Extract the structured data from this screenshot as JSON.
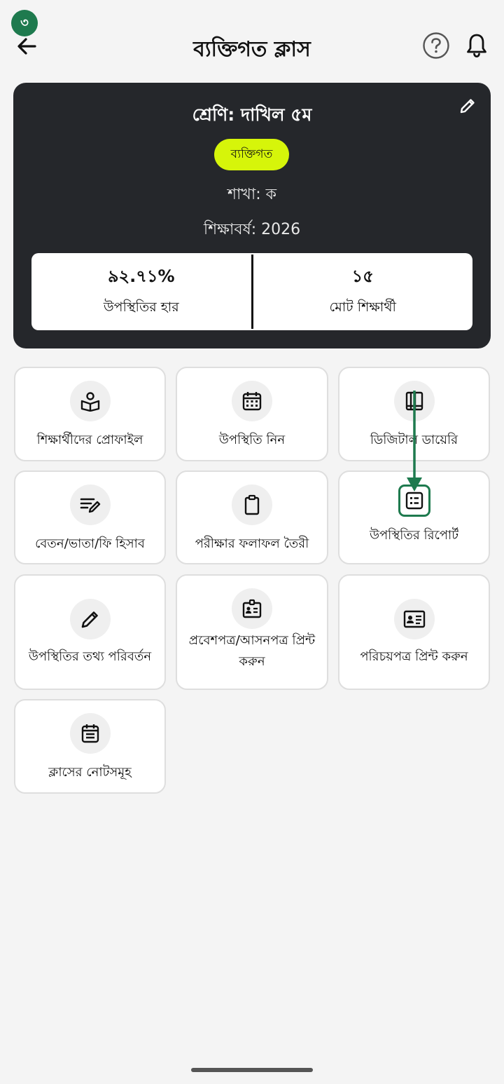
{
  "step_badge": "৩",
  "header": {
    "title": "ব্যক্তিগত ক্লাস",
    "icons": {
      "back": "arrow-left-icon",
      "help": "question-circle-icon",
      "notify": "bell-icon"
    }
  },
  "class_card": {
    "class_name": "শ্রেণি: দাখিল ৫ম",
    "type_chip": "ব্যক্তিগত",
    "section": "শাখা: ক",
    "academic_year": "শিক্ষাবর্ষ: 2026",
    "stats": [
      {
        "value": "৯২.৭১%",
        "label": "উপস্থিতির হার"
      },
      {
        "value": "১৫",
        "label": "মোট শিক্ষার্থী"
      }
    ],
    "edit_icon": "pencil-icon"
  },
  "tiles": [
    {
      "label": "শিক্ষার্থীদের প্রোফাইল",
      "icon": "student-profile-icon"
    },
    {
      "label": "উপস্থিতি নিন",
      "icon": "calendar-grid-icon"
    },
    {
      "label": "ডিজিটাল ডায়েরি",
      "icon": "diary-book-icon"
    },
    {
      "label": "বেতন/ভাতা/ফি হিসাব",
      "icon": "edit-list-icon"
    },
    {
      "label": "পরীক্ষার ফলাফল তৈরী",
      "icon": "clipboard-icon"
    },
    {
      "label": "উপস্থিতির রিপোর্ট",
      "icon": "report-list-icon"
    },
    {
      "label": "উপস্থিতির তথ্য পরিবর্তন",
      "icon": "pencil-icon"
    },
    {
      "label": "প্রবেশপত্র/আসনপত্র প্রিন্ট করুন",
      "icon": "id-badge-icon"
    },
    {
      "label": "পরিচয়পত্র প্রিন্ট করুন",
      "icon": "id-card-icon"
    },
    {
      "label": "ক্লাসের নোটসমূহ",
      "icon": "notes-calendar-icon"
    }
  ],
  "colors": {
    "accent_green": "#1e7a4e",
    "chip_yellow": "#d6f50a",
    "card_dark": "#25272b"
  }
}
